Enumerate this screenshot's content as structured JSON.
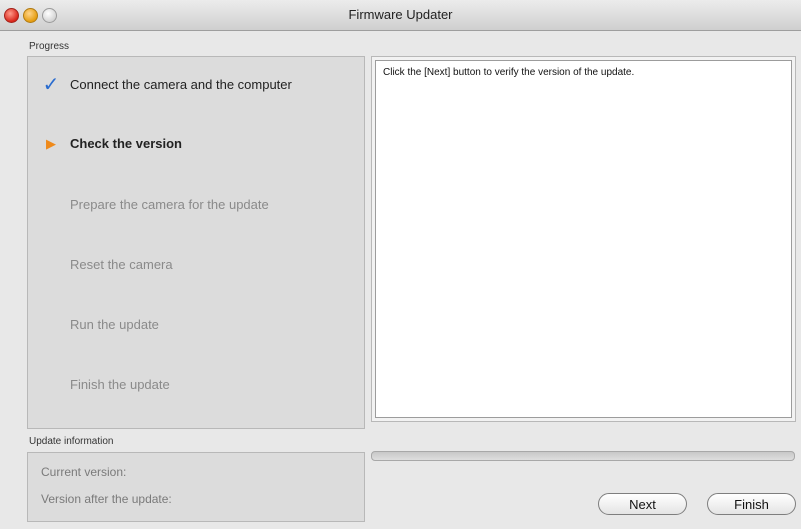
{
  "window": {
    "title": "Firmware Updater"
  },
  "progress": {
    "label": "Progress",
    "steps": [
      {
        "label": "Connect the camera and the computer",
        "status": "done",
        "marker": "✓"
      },
      {
        "label": "Check the version",
        "status": "current",
        "marker": "▶"
      },
      {
        "label": "Prepare the camera for the update",
        "status": "pending",
        "marker": ""
      },
      {
        "label": "Reset the camera",
        "status": "pending",
        "marker": ""
      },
      {
        "label": "Run the update",
        "status": "pending",
        "marker": ""
      },
      {
        "label": "Finish the update",
        "status": "pending",
        "marker": ""
      }
    ]
  },
  "message": {
    "text": "Click the [Next] button to verify the version of the update."
  },
  "update_info": {
    "label": "Update information",
    "current_version_label": "Current version:",
    "after_update_label": "Version after the update:"
  },
  "progress_bar": {
    "fraction": 0
  },
  "buttons": {
    "next_label": "Next",
    "finish_label": "Finish"
  },
  "colors": {
    "done_marker": "#2a6ccf",
    "current_marker": "#ef8a1b"
  },
  "icons": {
    "done": "checkmark-icon",
    "current": "arrow-right-icon"
  }
}
